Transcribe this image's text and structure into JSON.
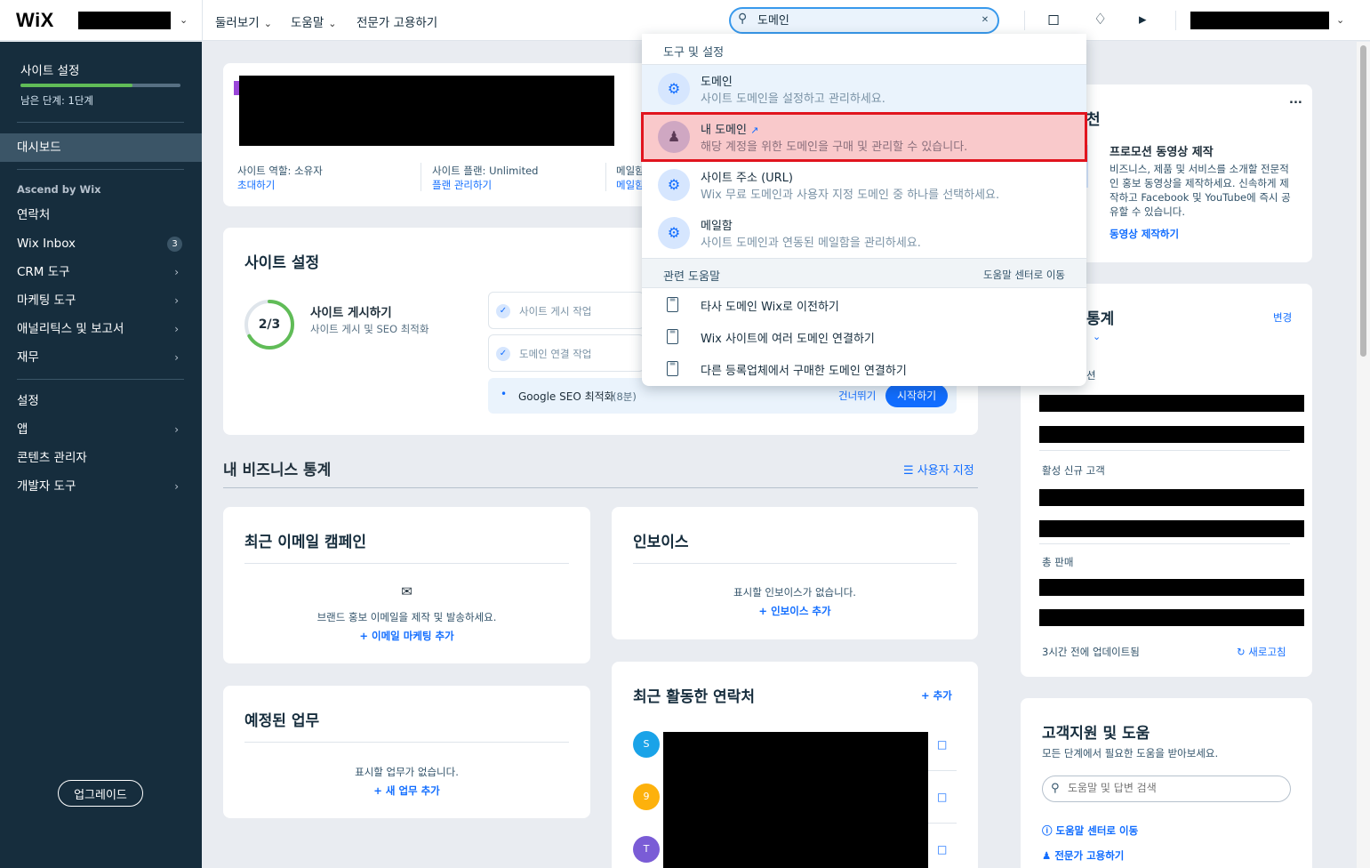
{
  "topbar": {
    "logo": "WiX",
    "nav": [
      "둘러보기",
      "도움말",
      "전문가 고용하기"
    ],
    "search_value": "도메인",
    "icons": [
      "chat-icon",
      "bell-icon",
      "megaphone-icon"
    ]
  },
  "sidebar": {
    "setup_title": "사이트 설정",
    "progress": 0.7,
    "steps_left": "남은 단계: 1단계",
    "dashboard": "대시보드",
    "section_ascend": "Ascend by Wix",
    "items": [
      {
        "label": "연락처"
      },
      {
        "label": "Wix Inbox",
        "badge": "3"
      },
      {
        "label": "CRM 도구"
      },
      {
        "label": "마케팅 도구"
      },
      {
        "label": "애널리틱스 및 보고서"
      },
      {
        "label": "재무"
      }
    ],
    "items2": [
      {
        "label": "설정"
      },
      {
        "label": "앱"
      },
      {
        "label": "콘텐츠 관리자"
      },
      {
        "label": "개발자 도구"
      }
    ],
    "upgrade": "업그레이드"
  },
  "site_info": {
    "role_label": "사이트 역할: 소유자",
    "invite": "초대하기",
    "plan_label": "사이트 플랜: Unlimited",
    "plan_manage": "플랜 관리하기",
    "mailbox_label": "메일함",
    "mailbox_link": "메일함"
  },
  "site_setup": {
    "title": "사이트 설정",
    "progress_text": "2/3",
    "progress": 0.667,
    "step_title": "사이트 게시하기",
    "step_desc": "사이트 게시 및 SEO 최적화",
    "task1": "사이트 게시 작업",
    "task2": "도메인 연결 작업",
    "task3": "Google SEO 최적화",
    "task3_time": "(8분)",
    "skip": "건너뛰기",
    "start": "시작하기"
  },
  "biz_stats": {
    "title": "내 비즈니스 통계",
    "customize": "사용자 지정"
  },
  "email_card": {
    "title": "최근 이메일 캠페인",
    "desc": "브랜드 홍보 이메일을 제작 및 발송하세요.",
    "link": "이메일 마케팅 추가"
  },
  "invoice_card": {
    "title": "인보이스",
    "desc": "표시할 인보이스가 없습니다.",
    "link": "인보이스 추가"
  },
  "tasks_card": {
    "title": "예정된 업무",
    "desc": "표시할 업무가 없습니다.",
    "link": "새 업무 추가"
  },
  "contacts_card": {
    "title": "최근 활동한 연락처",
    "add": "추가",
    "avatars": [
      {
        "letter": "S",
        "color": "#1aa3e8"
      },
      {
        "letter": "9",
        "color": "#fdb10c"
      },
      {
        "letter": "T",
        "color": "#7a5cd6"
      }
    ]
  },
  "right_promo": {
    "title_fragment": "천",
    "more": "...",
    "promo_title": "프로모션 동영상 제작",
    "promo_desc": "비즈니스, 제품 및 서비스를 소개할 전문적인 홍보 동영상을 제작하세요. 신속하게 제작하고 Facebook 및 YouTube에 즉시 공유할 수 있습니다.",
    "promo_link": "동영상 제작하기"
  },
  "right_stats": {
    "title_fragment": "통계",
    "change": "변경",
    "row_fragment": "션",
    "label2": "활성 신규 고객",
    "label3": "총 판매",
    "updated": "3시간 전에 업데이트됨",
    "refresh": "새로고침"
  },
  "support": {
    "title": "고객지원 및 도움",
    "desc": "모든 단계에서 필요한 도움을 받아보세요.",
    "search_placeholder": "도움말 및 답변 검색",
    "help_center": "도움말 센터로 이동",
    "hire": "전문가 고용하기"
  },
  "dropdown": {
    "section1": "도구 및 설정",
    "items": [
      {
        "title": "도메인",
        "desc": "사이트 도메인을 설정하고 관리하세요."
      },
      {
        "title": "내 도메인",
        "desc": "해당 계정을 위한 도메인을 구매 및 관리할 수 있습니다."
      },
      {
        "title": "사이트 주소 (URL)",
        "desc": "Wix 무료 도메인과 사용자 지정 도메인 중 하나를 선택하세요."
      },
      {
        "title": "메일함",
        "desc": "사이트 도메인과 연동된 메일함을 관리하세요."
      }
    ],
    "section2": "관련 도움말",
    "section2_link": "도움말 센터로 이동",
    "docs": [
      "타사 도메인 Wix로 이전하기",
      "Wix 사이트에 여러 도메인 연결하기",
      "다른 등록업체에서 구매한 도메인 연결하기"
    ]
  }
}
